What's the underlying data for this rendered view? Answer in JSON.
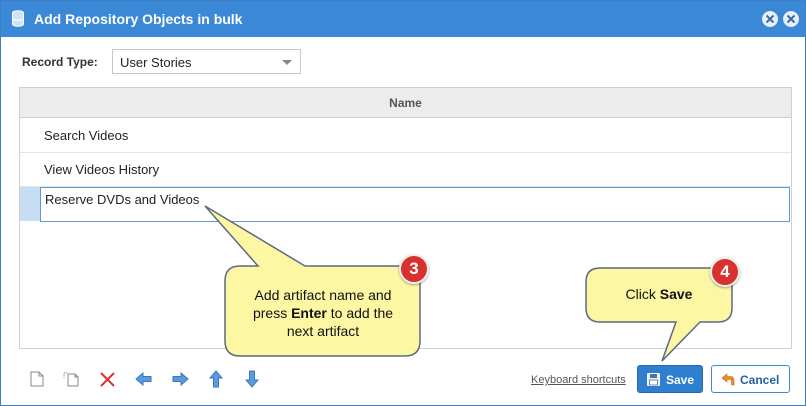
{
  "window": {
    "title": "Add Repository Objects in bulk",
    "icon": "database-icon",
    "controls": [
      "minimize-icon",
      "close-icon"
    ]
  },
  "record_type": {
    "label": "Record Type:",
    "selected": "User Stories"
  },
  "grid": {
    "column_header": "Name",
    "rows": [
      "Search Videos",
      "View Videos History"
    ],
    "editing_value": "Reserve DVDs and Videos"
  },
  "toolbar": {
    "icons": [
      "new-row-icon",
      "insert-row-icon",
      "delete-icon",
      "outdent-icon",
      "indent-icon",
      "move-up-icon",
      "move-down-icon"
    ]
  },
  "footer": {
    "keyboard_shortcuts": "Keyboard shortcuts",
    "save_label": "Save",
    "cancel_label": "Cancel"
  },
  "callouts": {
    "step3": {
      "number": "3",
      "line1": "Add artifact name and",
      "line2_pre": "press ",
      "line2_bold": "Enter",
      "line2_post": " to add the",
      "line3": "next artifact"
    },
    "step4": {
      "number": "4",
      "pre": "Click ",
      "bold": "Save"
    }
  },
  "colors": {
    "titlebar": "#3b88d6",
    "callout_fill": "#fdf6a3",
    "callout_border": "#5a6a80",
    "badge": "#d9312f",
    "save_button": "#2f7fcf"
  }
}
